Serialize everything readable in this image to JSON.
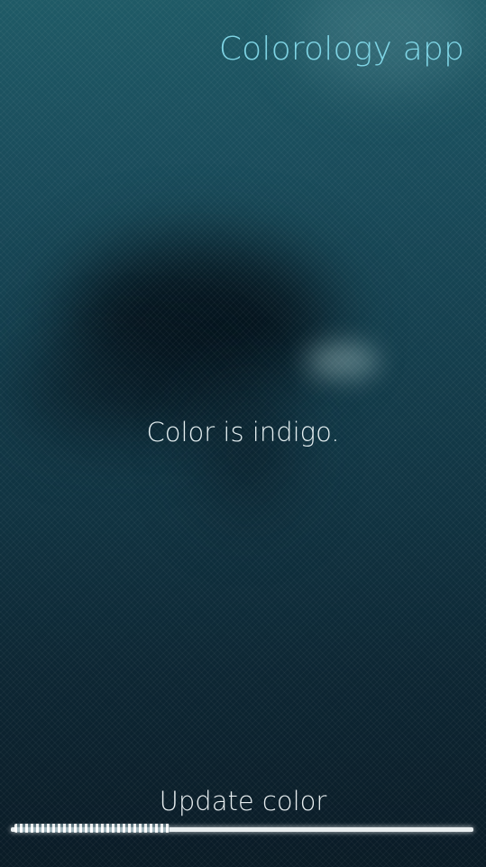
{
  "header": {
    "title": "Colorology app"
  },
  "main": {
    "color_text": "Color is indigo."
  },
  "pull_down_menu": {
    "items": [
      {
        "label": "Update color"
      }
    ]
  },
  "colors": {
    "header_accent": "#7fd4e4",
    "text_primary": "#e6f0f2"
  }
}
